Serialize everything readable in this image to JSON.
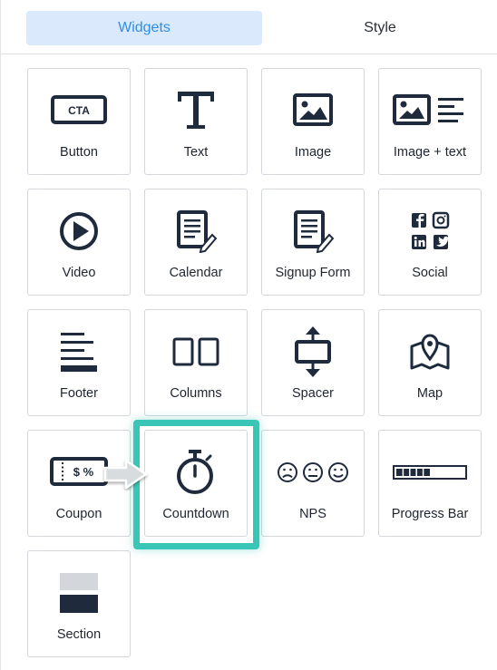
{
  "tabs": {
    "widgets_label": "Widgets",
    "style_label": "Style"
  },
  "widgets": {
    "button": {
      "label": "Button",
      "icon_text": "CTA"
    },
    "text": {
      "label": "Text"
    },
    "image": {
      "label": "Image"
    },
    "image_text": {
      "label": "Image + text"
    },
    "video": {
      "label": "Video"
    },
    "calendar": {
      "label": "Calendar"
    },
    "signup_form": {
      "label": "Signup Form"
    },
    "social": {
      "label": "Social"
    },
    "footer": {
      "label": "Footer"
    },
    "columns": {
      "label": "Columns"
    },
    "spacer": {
      "label": "Spacer"
    },
    "map": {
      "label": "Map"
    },
    "coupon": {
      "label": "Coupon",
      "icon_text": "$ %"
    },
    "countdown": {
      "label": "Countdown"
    },
    "nps": {
      "label": "NPS"
    },
    "progress_bar": {
      "label": "Progress Bar",
      "progress": 0.5
    },
    "section": {
      "label": "Section"
    }
  },
  "highlighted_widget": "countdown",
  "colors": {
    "icon": "#1f2b3d",
    "accent": "#2f8ee8",
    "active_tab_bg": "#daeafc",
    "highlight": "#39c6b6"
  },
  "icons": [
    "cta-icon",
    "text-icon",
    "image-icon",
    "image-text-icon",
    "play-icon",
    "calendar-icon",
    "signup-form-icon",
    "social-icon",
    "footer-icon",
    "columns-icon",
    "spacer-icon",
    "map-icon",
    "coupon-icon",
    "stopwatch-icon",
    "nps-faces-icon",
    "progress-bar-icon",
    "section-icon"
  ]
}
